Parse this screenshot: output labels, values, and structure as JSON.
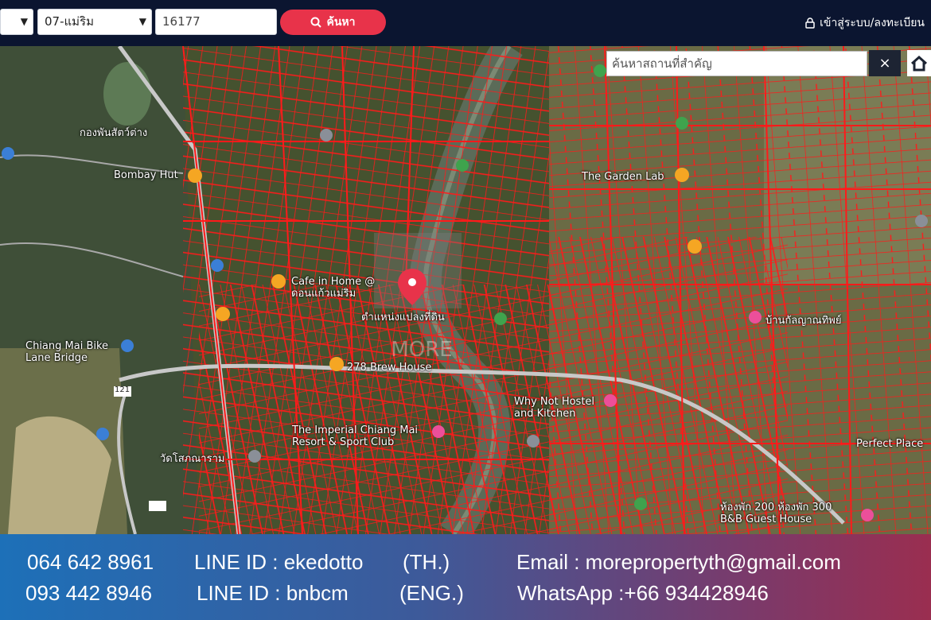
{
  "toolbar": {
    "district_value": "07-แม่ริม",
    "zone_value": "",
    "parcel_input": "16177",
    "search_label": "ค้นหา",
    "login_label": "เข้าสู่ระบบ/ลงทะเบียน"
  },
  "map": {
    "place_search_placeholder": "ค้นหาสถานที่สำคัญ",
    "close_label": "×",
    "watermark": "MORE",
    "labels": [
      "Bombay Hut",
      "กองพันสัตว์ต่าง",
      "Chiang Mai Bike Lane Bridge",
      "Cafe in Home @ ดอนแก้วแม่ริม",
      "278 Brew House",
      "The Garden Lab",
      "Why Not Hostel and Kitchen",
      "The Imperial Chiang Mai Resort & Sport Club",
      "Perfect Place",
      "ห้องพัก 200 ห้องพัก 300 B&B Guest House",
      "วัดโสภณาราม",
      "บ้านกัลญาณทิพย์",
      "ตำแหน่งแปลงที่ดิน",
      "121"
    ],
    "colors": {
      "parcel_lines": "#ff1a1a",
      "pin": "#e8334a"
    }
  },
  "footer": {
    "phone_th": "064 642 8961",
    "line_th": "LINE ID : ekedotto",
    "lang_th": "(TH.)",
    "email": "Email : morepropertyth@gmail.com",
    "phone_en": "093 442 8946",
    "line_en": "LINE ID : bnbcm",
    "lang_en": "(ENG.)",
    "whatsapp": "WhatsApp :+66 934428946"
  }
}
